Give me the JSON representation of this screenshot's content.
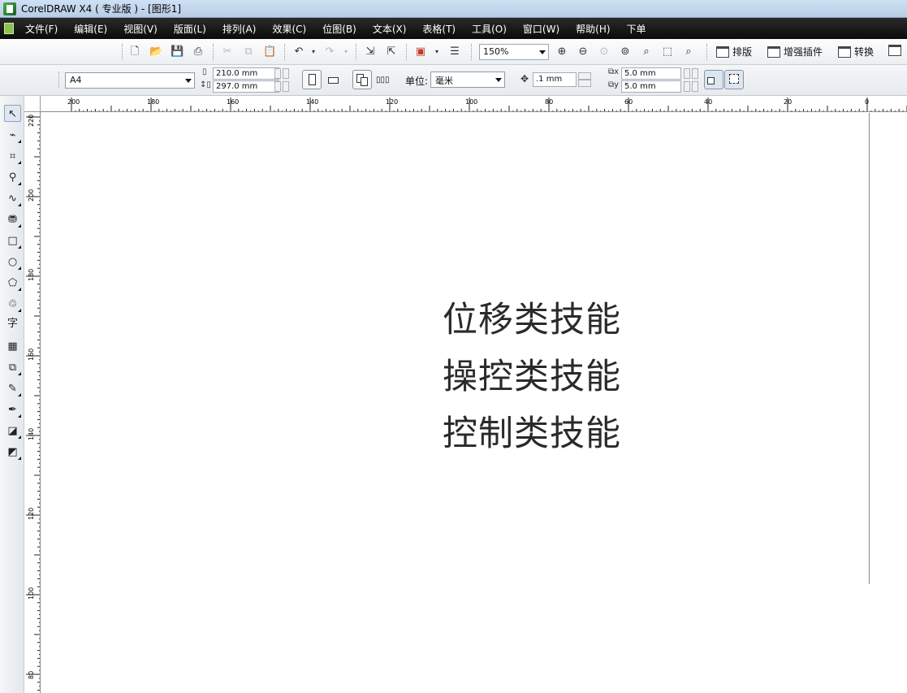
{
  "window": {
    "title": "CorelDRAW X4 ( 专业版 ) - [图形1]"
  },
  "menu": [
    "文件(F)",
    "编辑(E)",
    "视图(V)",
    "版面(L)",
    "排列(A)",
    "效果(C)",
    "位图(B)",
    "文本(X)",
    "表格(T)",
    "工具(O)",
    "窗口(W)",
    "帮助(H)",
    "下单"
  ],
  "toolbar": {
    "zoom_value": "150%",
    "plugin_buttons": [
      "排版",
      "增强插件",
      "转换"
    ]
  },
  "property_bar": {
    "paper_size": "A4",
    "width": "210.0 mm",
    "height": "297.0 mm",
    "unit_label": "单位:",
    "unit_value": "毫米",
    "nudge": ".1 mm",
    "dup_x": "5.0 mm",
    "dup_y": "5.0 mm"
  },
  "rulers": {
    "horizontal": [
      "200",
      "180",
      "160",
      "140",
      "120",
      "100",
      "80",
      "60",
      "40",
      "20",
      "0"
    ],
    "vertical": [
      "220",
      "200",
      "180",
      "160",
      "140",
      "120",
      "100",
      "80"
    ]
  },
  "canvas": {
    "text_lines": [
      "位移类技能",
      "操控类技能",
      "控制类技能"
    ]
  },
  "colors": {
    "menubar_bg": "#111111",
    "titlebar_bg": "#c4d7ee",
    "canvas_bg": "#ffffff",
    "text_color": "#2a2a2a"
  }
}
